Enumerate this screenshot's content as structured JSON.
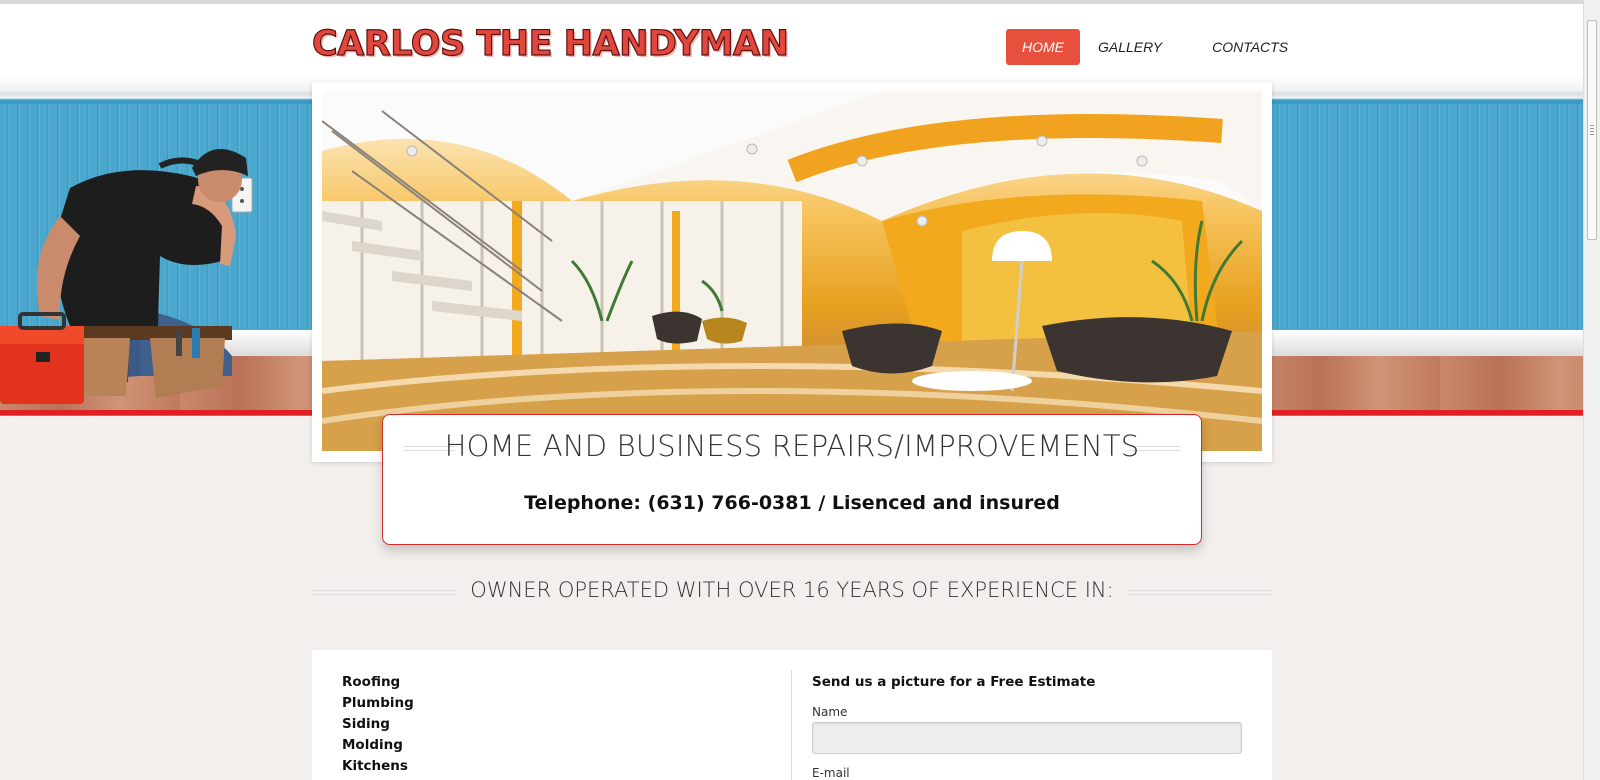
{
  "header": {
    "logo": "CARLOS THE HANDYMAN",
    "nav": [
      {
        "label": "HOME",
        "active": true
      },
      {
        "label": "GALLERY",
        "active": false
      },
      {
        "label": "CONTACTS",
        "active": false
      }
    ]
  },
  "hero": {
    "image": "modern-interior-photo",
    "background": "handyman-at-wall-illustration"
  },
  "callout": {
    "title": "HOME AND BUSINESS REPAIRS/IMPROVEMENTS",
    "phone": "Telephone: (631) 766-0381 / Lisenced and insured"
  },
  "section": {
    "heading": "OWNER OPERATED WITH OVER 16 YEARS OF EXPERIENCE IN:"
  },
  "services": [
    "Roofing",
    "Plumbing",
    "Siding",
    "Molding",
    "Kitchens"
  ],
  "form": {
    "title": "Send us a picture for a Free Estimate",
    "name_label": "Name",
    "email_label": "E-mail"
  },
  "colors": {
    "accent": "#e8503e",
    "band_blue": "#4aa8cf",
    "redline": "#e02020"
  }
}
